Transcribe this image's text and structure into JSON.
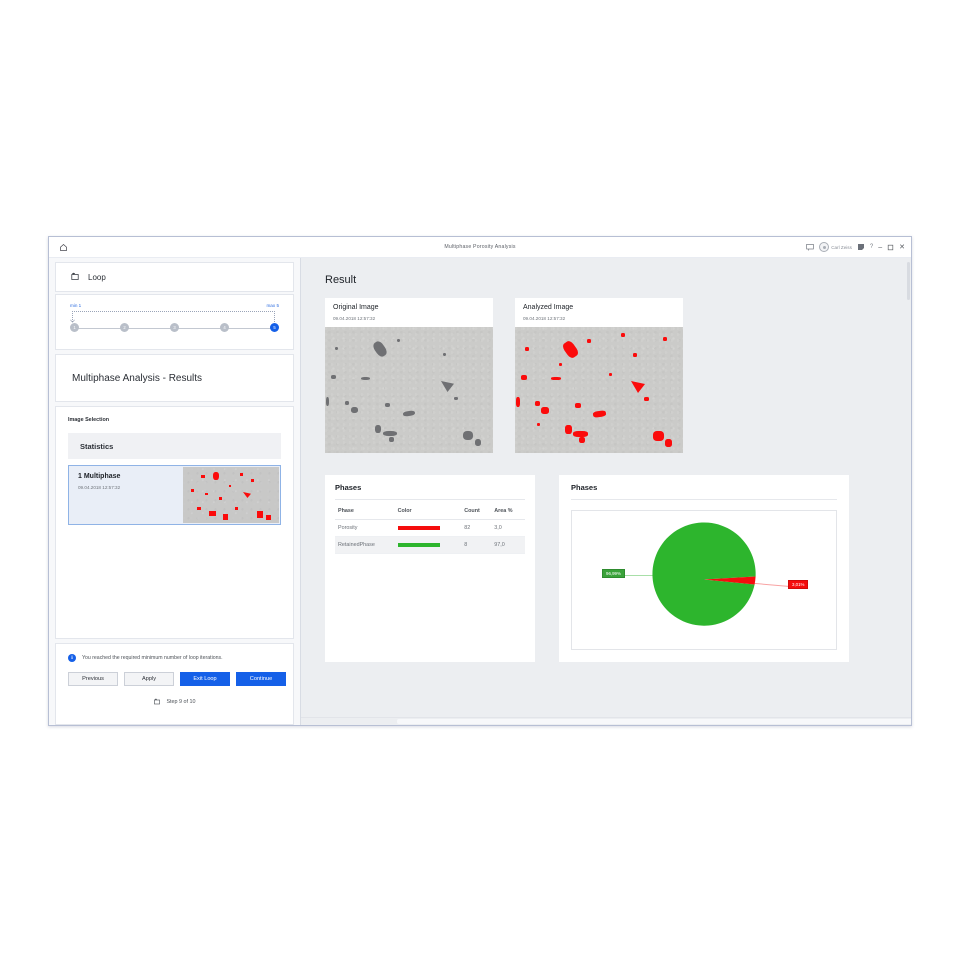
{
  "window": {
    "title": "Multiphase Porosity Analysis",
    "home_icon": "home-icon",
    "titlebar_icons": {
      "comment": "comment-icon",
      "note": "note-icon",
      "help": "?",
      "minimize": "–",
      "maximize": "❐",
      "close": "✕"
    },
    "user": "Carl Zeiss"
  },
  "sidebar": {
    "loop": {
      "icon": "loop-icon",
      "title": "Loop",
      "min_label": "min 1",
      "max_label": "max 5",
      "steps": [
        {
          "label": "1",
          "active": false
        },
        {
          "label": "2",
          "active": false
        },
        {
          "label": "3",
          "active": false
        },
        {
          "label": "4",
          "active": false
        },
        {
          "label": "5",
          "active": true
        }
      ]
    },
    "analysis_title": "Multiphase Analysis - Results",
    "image_selection_label": "Image Selection",
    "statistics_label": "Statistics",
    "result_item": {
      "title": "1 Multiphase",
      "date": "09.04.2018 12:57:32"
    },
    "info_message": "You reached the required minimum number of loop iterations.",
    "info_badge": "i",
    "buttons": [
      {
        "label": "Previous",
        "primary": false
      },
      {
        "label": "Apply",
        "primary": false
      },
      {
        "label": "Exit Loop",
        "primary": true
      },
      {
        "label": "Continue",
        "primary": true
      }
    ],
    "step_footer": {
      "icon": "loop-icon",
      "label": "Step 9 of 10"
    }
  },
  "main": {
    "title": "Result",
    "images": [
      {
        "title": "Original Image",
        "date": "09.04.2018 12:57:32"
      },
      {
        "title": "Analyzed Image",
        "date": "09.04.2018 12:57:32"
      }
    ],
    "phases_table": {
      "title": "Phases",
      "columns": [
        "Phase",
        "Color",
        "Count",
        "Area %"
      ],
      "rows": [
        {
          "phase": "Porosity",
          "color": "#f50d0d",
          "count": "82",
          "area": "3,0"
        },
        {
          "phase": "RetainedPhase",
          "color": "#2db52d",
          "count": "8",
          "area": "97,0"
        }
      ]
    },
    "chart_panel_title": "Phases"
  },
  "chart_data": {
    "type": "pie",
    "title": "Phases",
    "labels": [
      "RetainedPhase",
      "Porosity"
    ],
    "values": [
      96.99,
      3.01
    ],
    "value_labels": [
      "96,99%",
      "3,01%"
    ],
    "colors": [
      "#2db52d",
      "#f50d0d"
    ],
    "legend": "none",
    "units": "%"
  }
}
